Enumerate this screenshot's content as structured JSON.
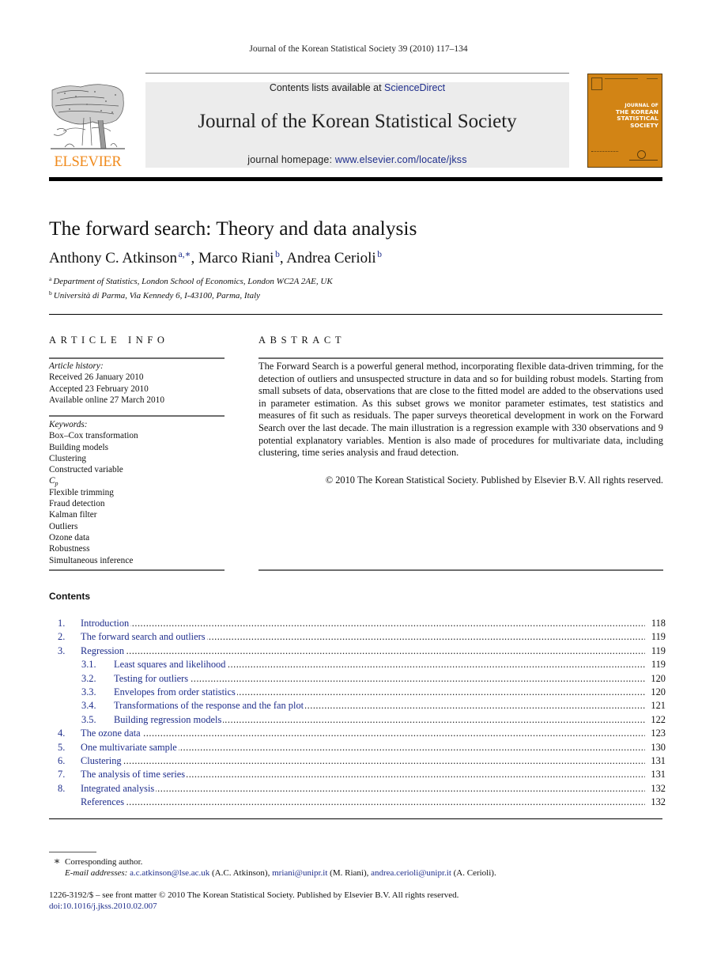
{
  "running_header": "Journal of the Korean Statistical Society 39 (2010) 117–134",
  "masthead": {
    "publisher_logo_text": "ELSEVIER",
    "contents_prefix": "Contents lists available at ",
    "contents_link": "ScienceDirect",
    "journal_title": "Journal of the Korean Statistical Society",
    "homepage_prefix": "journal homepage: ",
    "homepage_link": "www.elsevier.com/locate/jkss",
    "cover": {
      "line1": "JOURNAL OF",
      "line2": "THE KOREAN",
      "line3": "STATISTICAL",
      "line4": "SOCIETY",
      "color": "#d28415"
    },
    "logo_color": "#f08a1c"
  },
  "article": {
    "title": "The forward search: Theory and data analysis",
    "authors": [
      {
        "name": "Anthony C. Atkinson",
        "marks": "a,∗",
        "sep": ", "
      },
      {
        "name": "Marco Riani",
        "marks": "b",
        "sep": ", "
      },
      {
        "name": "Andrea Cerioli",
        "marks": "b",
        "sep": ""
      }
    ],
    "affiliations": [
      {
        "mark": "a",
        "text": "Department of Statistics, London School of Economics, London WC2A 2AE, UK"
      },
      {
        "mark": "b",
        "text": "Università di Parma, Via Kennedy 6, I-43100, Parma, Italy"
      }
    ]
  },
  "article_info": {
    "heading": "ARTICLE INFO",
    "history_label": "Article history:",
    "history": [
      "Received 26 January 2010",
      "Accepted 23 February 2010",
      "Available online 27 March 2010"
    ],
    "keywords_label": "Keywords:",
    "keywords": [
      "Box–Cox transformation",
      "Building models",
      "Clustering",
      "Constructed variable",
      "Cp",
      "Flexible trimming",
      "Fraud detection",
      "Kalman filter",
      "Outliers",
      "Ozone data",
      "Robustness",
      "Simultaneous inference"
    ]
  },
  "abstract": {
    "heading": "ABSTRACT",
    "text": "The Forward Search is a powerful general method, incorporating flexible data-driven trimming, for the detection of outliers and unsuspected structure in data and so for building robust models. Starting from small subsets of data, observations that are close to the fitted model are added to the observations used in parameter estimation. As this subset grows we monitor parameter estimates, test statistics and measures of fit such as residuals. The paper surveys theoretical development in work on the Forward Search over the last decade. The main illustration is a regression example with 330 observations and 9 potential explanatory variables. Mention is also made of procedures for multivariate data, including clustering, time series analysis and fraud detection.",
    "copyright": "© 2010 The Korean Statistical Society. Published by Elsevier B.V. All rights reserved."
  },
  "contents": {
    "heading": "Contents",
    "items": [
      {
        "num": "1.",
        "title": "Introduction",
        "page": "118",
        "level": 1
      },
      {
        "num": "2.",
        "title": "The forward search and outliers",
        "page": "119",
        "level": 1
      },
      {
        "num": "3.",
        "title": "Regression",
        "page": "119",
        "level": 1
      },
      {
        "num": "3.1.",
        "title": "Least squares and likelihood",
        "page": "119",
        "level": 2
      },
      {
        "num": "3.2.",
        "title": "Testing for outliers",
        "page": "120",
        "level": 2
      },
      {
        "num": "3.3.",
        "title": "Envelopes from order statistics",
        "page": "120",
        "level": 2
      },
      {
        "num": "3.4.",
        "title": "Transformations of the response and the fan plot",
        "page": "121",
        "level": 2
      },
      {
        "num": "3.5.",
        "title": "Building regression models",
        "page": "122",
        "level": 2
      },
      {
        "num": "4.",
        "title": "The ozone data",
        "page": "123",
        "level": 1
      },
      {
        "num": "5.",
        "title": "One multivariate sample",
        "page": "130",
        "level": 1
      },
      {
        "num": "6.",
        "title": "Clustering",
        "page": "131",
        "level": 1
      },
      {
        "num": "7.",
        "title": "The analysis of time series",
        "page": "131",
        "level": 1
      },
      {
        "num": "8.",
        "title": "Integrated analysis",
        "page": "132",
        "level": 1
      },
      {
        "num": "",
        "title": "References",
        "page": "132",
        "level": 1
      }
    ]
  },
  "footnotes": {
    "star": "∗",
    "corresponding": "Corresponding author.",
    "email_label": "E-mail addresses:",
    "emails": [
      {
        "address": "a.c.atkinson@lse.ac.uk",
        "who": " (A.C. Atkinson), "
      },
      {
        "address": "mriani@unipr.it",
        "who": " (M. Riani), "
      },
      {
        "address": "andrea.cerioli@unipr.it",
        "who": " (A. Cerioli)."
      }
    ],
    "issn_line": "1226-3192/$ – see front matter © 2010 The Korean Statistical Society. Published by Elsevier B.V. All rights reserved.",
    "doi": "doi:10.1016/j.jkss.2010.02.007"
  },
  "colors": {
    "link": "#1f2e8c",
    "masthead_bg": "#ececec"
  }
}
